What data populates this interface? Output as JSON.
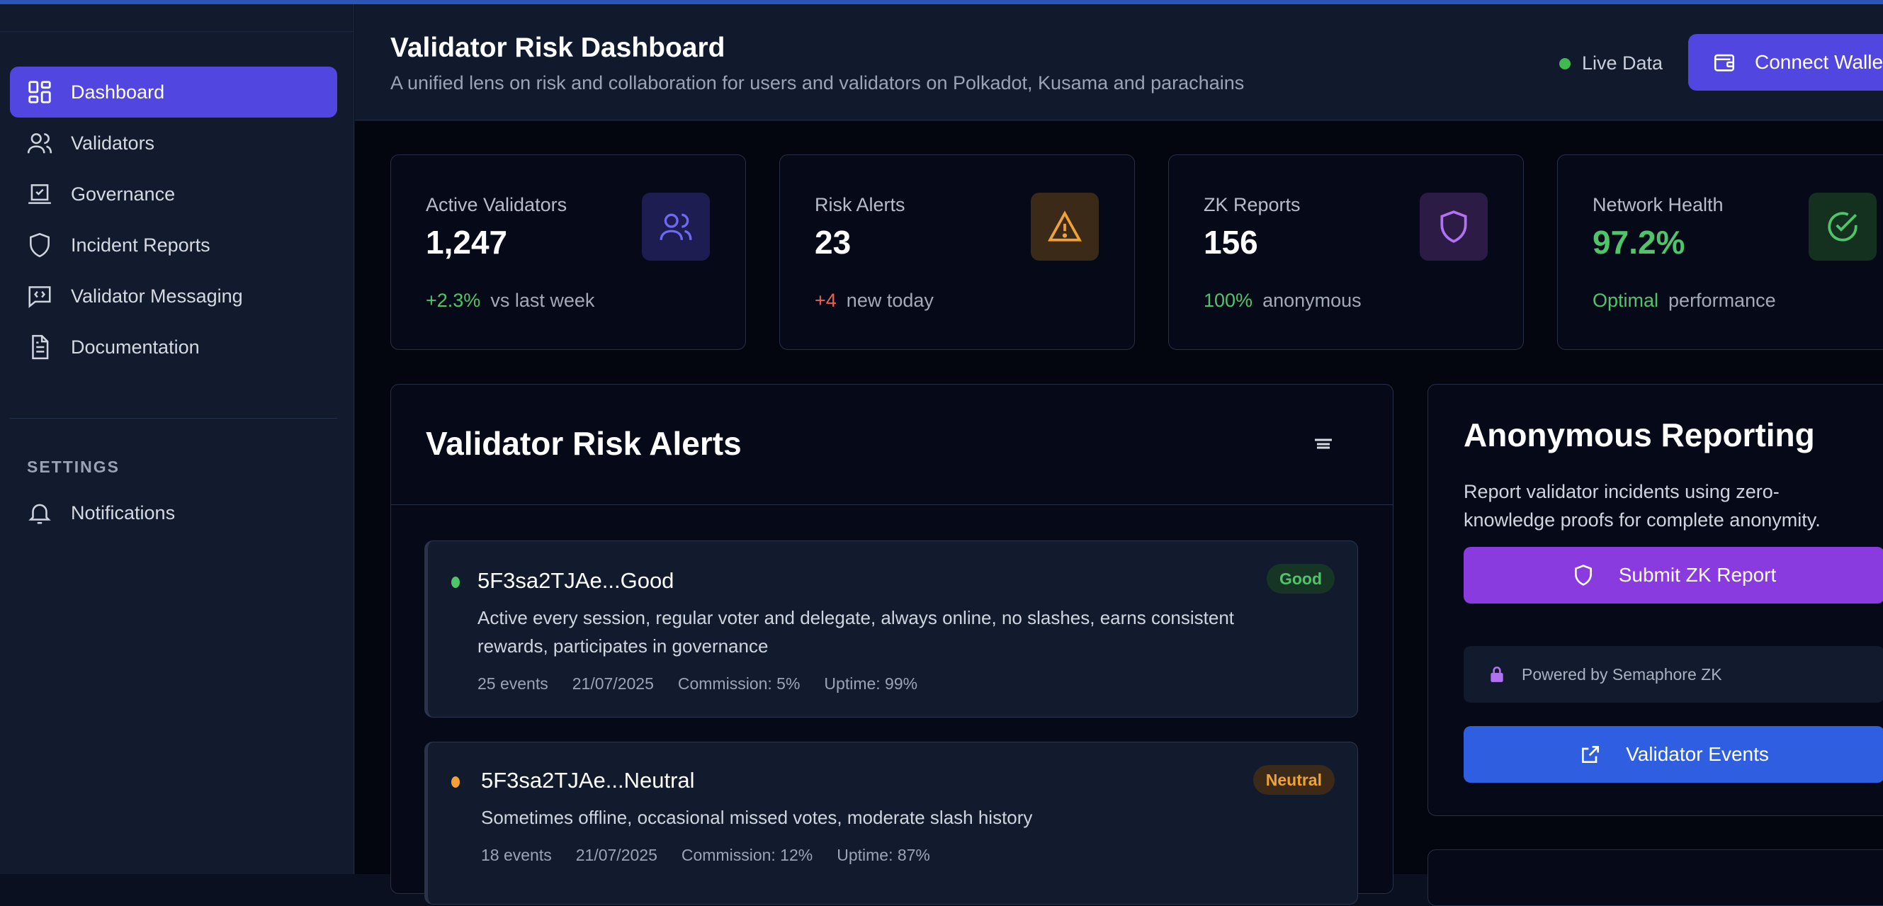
{
  "sidebar": {
    "items": [
      {
        "label": "Dashboard",
        "icon": "dashboard-grid-icon",
        "active": true
      },
      {
        "label": "Validators",
        "icon": "users-icon"
      },
      {
        "label": "Governance",
        "icon": "ballot-box-icon"
      },
      {
        "label": "Incident Reports",
        "icon": "shield-icon"
      },
      {
        "label": "Validator Messaging",
        "icon": "code-message-icon"
      },
      {
        "label": "Documentation",
        "icon": "document-icon"
      }
    ],
    "section_label": "SETTINGS",
    "settings_items": [
      {
        "label": "Notifications",
        "icon": "bell-icon"
      }
    ]
  },
  "header": {
    "title": "Validator Risk Dashboard",
    "subtitle": "A unified lens on risk and collaboration for users and validators on Polkadot, Kusama and parachains",
    "live_label": "Live Data",
    "connect_label": "Connect Wallet"
  },
  "stats": [
    {
      "label": "Active Validators",
      "value": "1,247",
      "delta": "+2.3%",
      "foot": "vs last week",
      "icon": "users-icon",
      "accent": "#6d6af0"
    },
    {
      "label": "Risk Alerts",
      "value": "23",
      "delta": "+4",
      "foot": "new today",
      "icon": "warning-triangle-icon",
      "accent": "#f0a236"
    },
    {
      "label": "ZK Reports",
      "value": "156",
      "delta": "100%",
      "foot": "anonymous",
      "icon": "shield-icon",
      "accent": "#b072f0"
    },
    {
      "label": "Network Health",
      "value": "97.2%",
      "delta": "Optimal",
      "foot": "performance",
      "icon": "check-circle-icon",
      "accent": "#4fc46a"
    }
  ],
  "alerts": {
    "title": "Validator Risk Alerts",
    "items": [
      {
        "name": "5F3sa2TJAe...Good",
        "status": "Good",
        "status_color": "#4fc46a",
        "description": "Active every session, regular voter and delegate, always online, no slashes, earns consistent rewards, participates in governance",
        "events": "25 events",
        "date": "21/07/2025",
        "commission": "Commission: 5%",
        "uptime": "Uptime: 99%"
      },
      {
        "name": "5F3sa2TJAe...Neutral",
        "status": "Neutral",
        "status_color": "#f0a236",
        "description": "Sometimes offline, occasional missed votes, moderate slash history",
        "events": "18 events",
        "date": "21/07/2025",
        "commission": "Commission: 12%",
        "uptime": "Uptime: 87%"
      }
    ]
  },
  "anonymous": {
    "title": "Anonymous Reporting",
    "description": "Report validator incidents using zero-knowledge proofs for complete anonymity.",
    "submit_label": "Submit ZK Report",
    "powered_label": "Powered by Semaphore ZK",
    "events_label": "Validator Events"
  },
  "colors": {
    "brand": "#5146e0",
    "zk_purple": "#8a3be0",
    "events_blue": "#2f5fe0",
    "positive": "#4fc46a",
    "negative": "#ef5d4e"
  }
}
